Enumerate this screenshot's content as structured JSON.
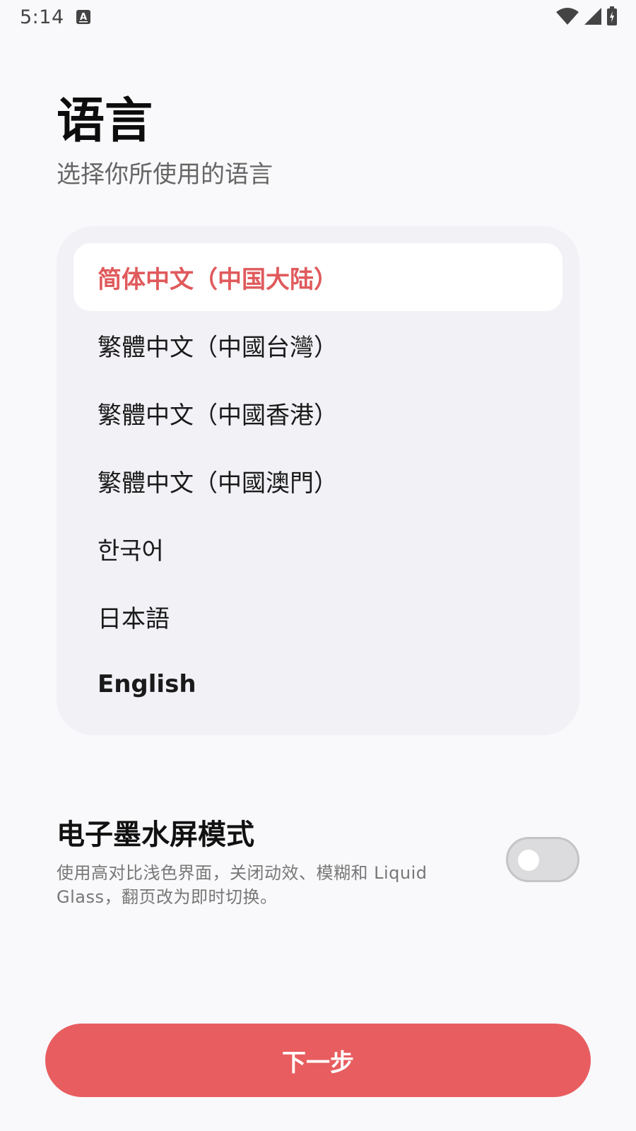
{
  "status_bar": {
    "time": "5:14",
    "icons": [
      "text-a-notification-icon",
      "wifi-icon",
      "cellular-signal-icon",
      "battery-charging-icon"
    ]
  },
  "header": {
    "title": "语言",
    "subtitle": "选择你所使用的语言"
  },
  "languages": {
    "selected_index": 0,
    "items": [
      {
        "label": "简体中文（中国大陆）",
        "selected": true
      },
      {
        "label": "繁體中文（中國台灣）",
        "selected": false
      },
      {
        "label": "繁體中文（中國香港）",
        "selected": false
      },
      {
        "label": "繁體中文（中國澳門）",
        "selected": false
      },
      {
        "label": "한국어",
        "selected": false
      },
      {
        "label": "日本語",
        "selected": false
      },
      {
        "label": "English",
        "selected": false
      }
    ]
  },
  "eink": {
    "title": "电子墨水屏模式",
    "description_line1": "使用高对比浅色界面，关闭动效、模糊和 Liquid",
    "description_line2": "Glass，翻页改为即时切换。",
    "enabled": false
  },
  "actions": {
    "next_label": "下一步"
  },
  "colors": {
    "accent": "#e85d5f",
    "selected_text": "#e05a5c",
    "card_background": "#f1f1f6",
    "page_background": "#f9f9fb"
  }
}
